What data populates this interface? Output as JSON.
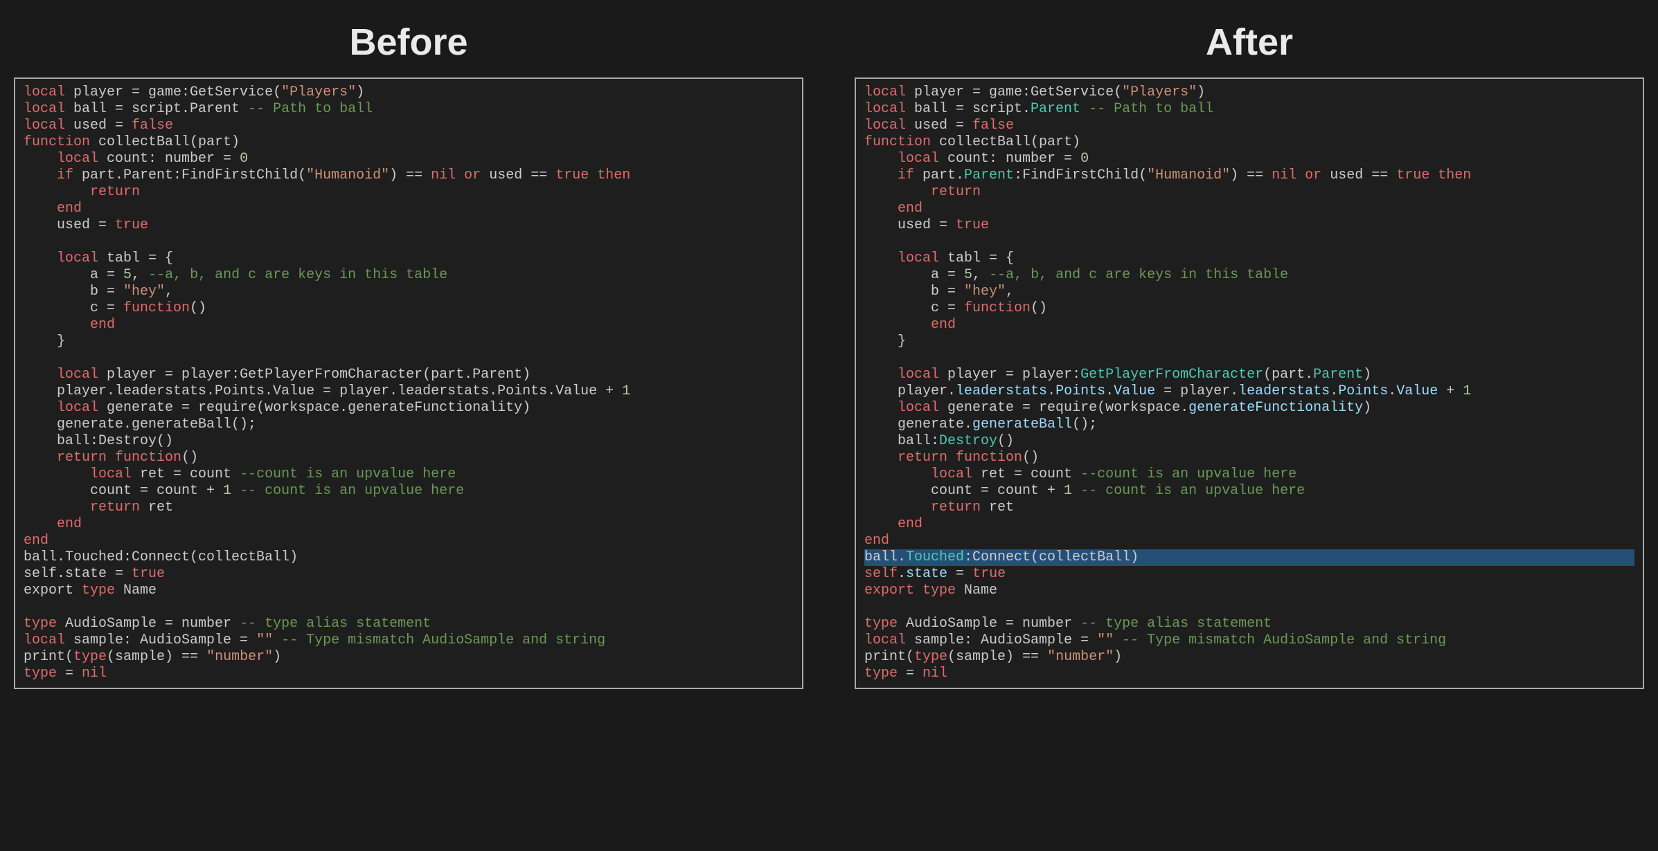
{
  "labels": {
    "before": "Before",
    "after": "After"
  },
  "colors": {
    "bg": "#1a1a1a",
    "panel": "#1e1e1e",
    "border": "#aaa",
    "keyword": "#e06c6c",
    "string": "#ce9178",
    "number": "#b5cea8",
    "comment": "#6a9955",
    "member_after": "#4ec9b0",
    "prop_after": "#9cdcfe",
    "highlight_line": "#264f78",
    "text": "#ccc"
  },
  "code": {
    "before": [
      {
        "t": [
          [
            "kw",
            "local"
          ],
          [
            "def",
            " player = game:GetService("
          ],
          [
            "str",
            "\"Players\""
          ],
          [
            "def",
            ")"
          ]
        ]
      },
      {
        "t": [
          [
            "kw",
            "local"
          ],
          [
            "def",
            " ball = script.Parent "
          ],
          [
            "cmt",
            "-- Path to ball"
          ]
        ]
      },
      {
        "t": [
          [
            "kw",
            "local"
          ],
          [
            "def",
            " used = "
          ],
          [
            "bool",
            "false"
          ]
        ]
      },
      {
        "t": [
          [
            "kw",
            "function"
          ],
          [
            "def",
            " collectBall(part)"
          ]
        ]
      },
      {
        "t": [
          [
            "def",
            "    "
          ],
          [
            "kw",
            "local"
          ],
          [
            "def",
            " count: number = "
          ],
          [
            "num",
            "0"
          ]
        ]
      },
      {
        "t": [
          [
            "def",
            "    "
          ],
          [
            "kw",
            "if"
          ],
          [
            "def",
            " part.Parent:FindFirstChild("
          ],
          [
            "str",
            "\"Humanoid\""
          ],
          [
            "def",
            ") == "
          ],
          [
            "bool",
            "nil"
          ],
          [
            "def",
            " "
          ],
          [
            "kw",
            "or"
          ],
          [
            "def",
            " used == "
          ],
          [
            "bool",
            "true"
          ],
          [
            "def",
            " "
          ],
          [
            "kw",
            "then"
          ]
        ]
      },
      {
        "t": [
          [
            "def",
            "        "
          ],
          [
            "kw",
            "return"
          ]
        ]
      },
      {
        "t": [
          [
            "def",
            "    "
          ],
          [
            "kw",
            "end"
          ]
        ]
      },
      {
        "t": [
          [
            "def",
            "    used = "
          ],
          [
            "bool",
            "true"
          ]
        ]
      },
      {
        "t": [
          [
            "def",
            ""
          ]
        ]
      },
      {
        "t": [
          [
            "def",
            "    "
          ],
          [
            "kw",
            "local"
          ],
          [
            "def",
            " tabl = {"
          ]
        ]
      },
      {
        "t": [
          [
            "def",
            "        a = "
          ],
          [
            "num",
            "5"
          ],
          [
            "def",
            ", "
          ],
          [
            "cmt",
            "--a, b, and c are keys in this table"
          ]
        ]
      },
      {
        "t": [
          [
            "def",
            "        b = "
          ],
          [
            "str",
            "\"hey\""
          ],
          [
            "def",
            ","
          ]
        ]
      },
      {
        "t": [
          [
            "def",
            "        c = "
          ],
          [
            "kw",
            "function"
          ],
          [
            "def",
            "()"
          ]
        ]
      },
      {
        "t": [
          [
            "def",
            "        "
          ],
          [
            "kw",
            "end"
          ]
        ]
      },
      {
        "t": [
          [
            "def",
            "    }"
          ]
        ]
      },
      {
        "t": [
          [
            "def",
            ""
          ]
        ]
      },
      {
        "t": [
          [
            "def",
            "    "
          ],
          [
            "kw",
            "local"
          ],
          [
            "def",
            " player = player:GetPlayerFromCharacter(part.Parent)"
          ]
        ]
      },
      {
        "t": [
          [
            "def",
            "    player.leaderstats.Points.Value = player.leaderstats.Points.Value + "
          ],
          [
            "num",
            "1"
          ]
        ]
      },
      {
        "t": [
          [
            "def",
            "    "
          ],
          [
            "kw",
            "local"
          ],
          [
            "def",
            " generate = require(workspace.generateFunctionality)"
          ]
        ]
      },
      {
        "t": [
          [
            "def",
            "    generate.generateBall();"
          ]
        ]
      },
      {
        "t": [
          [
            "def",
            "    ball:Destroy()"
          ]
        ]
      },
      {
        "t": [
          [
            "def",
            "    "
          ],
          [
            "kw",
            "return"
          ],
          [
            "def",
            " "
          ],
          [
            "kw",
            "function"
          ],
          [
            "def",
            "()"
          ]
        ]
      },
      {
        "t": [
          [
            "def",
            "        "
          ],
          [
            "kw",
            "local"
          ],
          [
            "def",
            " ret = count "
          ],
          [
            "cmt",
            "--count is an upvalue here"
          ]
        ]
      },
      {
        "t": [
          [
            "def",
            "        count = count + "
          ],
          [
            "num",
            "1"
          ],
          [
            "def",
            " "
          ],
          [
            "cmt",
            "-- count is an upvalue here"
          ]
        ]
      },
      {
        "t": [
          [
            "def",
            "        "
          ],
          [
            "kw",
            "return"
          ],
          [
            "def",
            " ret"
          ]
        ]
      },
      {
        "t": [
          [
            "def",
            "    "
          ],
          [
            "kw",
            "end"
          ]
        ]
      },
      {
        "t": [
          [
            "kw",
            "end"
          ]
        ]
      },
      {
        "t": [
          [
            "def",
            "ball.Touched:Connect(collectBall)"
          ]
        ]
      },
      {
        "t": [
          [
            "def",
            "self.state = "
          ],
          [
            "bool",
            "true"
          ]
        ]
      },
      {
        "t": [
          [
            "def",
            "export "
          ],
          [
            "kw",
            "type"
          ],
          [
            "def",
            " Name"
          ]
        ]
      },
      {
        "t": [
          [
            "def",
            ""
          ]
        ]
      },
      {
        "t": [
          [
            "kw",
            "type"
          ],
          [
            "def",
            " AudioSample = number "
          ],
          [
            "cmt",
            "-- type alias statement"
          ]
        ]
      },
      {
        "t": [
          [
            "kw",
            "local"
          ],
          [
            "def",
            " sample: AudioSample = "
          ],
          [
            "str",
            "\"\""
          ],
          [
            "def",
            " "
          ],
          [
            "cmt",
            "-- Type mismatch AudioSample and string"
          ]
        ]
      },
      {
        "t": [
          [
            "def",
            "print("
          ],
          [
            "kw",
            "type"
          ],
          [
            "def",
            "(sample) == "
          ],
          [
            "str",
            "\"number\""
          ],
          [
            "def",
            ")"
          ]
        ]
      },
      {
        "t": [
          [
            "kw",
            "type"
          ],
          [
            "def",
            " = "
          ],
          [
            "bool",
            "nil"
          ]
        ]
      }
    ],
    "after": [
      {
        "t": [
          [
            "kw",
            "local"
          ],
          [
            "def",
            " player = game:GetService("
          ],
          [
            "str",
            "\"Players\""
          ],
          [
            "def",
            ")"
          ]
        ]
      },
      {
        "t": [
          [
            "kw",
            "local"
          ],
          [
            "def",
            " ball = script."
          ],
          [
            "mem",
            "Parent"
          ],
          [
            "def",
            " "
          ],
          [
            "cmt",
            "-- Path to ball"
          ]
        ]
      },
      {
        "t": [
          [
            "kw",
            "local"
          ],
          [
            "def",
            " used = "
          ],
          [
            "bool",
            "false"
          ]
        ]
      },
      {
        "t": [
          [
            "kw",
            "function"
          ],
          [
            "def",
            " collectBall(part)"
          ]
        ]
      },
      {
        "t": [
          [
            "def",
            "    "
          ],
          [
            "kw",
            "local"
          ],
          [
            "def",
            " count: number = "
          ],
          [
            "num",
            "0"
          ]
        ]
      },
      {
        "t": [
          [
            "def",
            "    "
          ],
          [
            "kw",
            "if"
          ],
          [
            "def",
            " part."
          ],
          [
            "mem",
            "Parent"
          ],
          [
            "def",
            ":FindFirstChild("
          ],
          [
            "str",
            "\"Humanoid\""
          ],
          [
            "def",
            ") == "
          ],
          [
            "bool",
            "nil"
          ],
          [
            "def",
            " "
          ],
          [
            "kw",
            "or"
          ],
          [
            "def",
            " used == "
          ],
          [
            "bool",
            "true"
          ],
          [
            "def",
            " "
          ],
          [
            "kw",
            "then"
          ]
        ]
      },
      {
        "t": [
          [
            "def",
            "        "
          ],
          [
            "kw",
            "return"
          ]
        ]
      },
      {
        "t": [
          [
            "def",
            "    "
          ],
          [
            "kw",
            "end"
          ]
        ]
      },
      {
        "t": [
          [
            "def",
            "    used = "
          ],
          [
            "bool",
            "true"
          ]
        ]
      },
      {
        "t": [
          [
            "def",
            ""
          ]
        ]
      },
      {
        "t": [
          [
            "def",
            "    "
          ],
          [
            "kw",
            "local"
          ],
          [
            "def",
            " tabl = {"
          ]
        ]
      },
      {
        "t": [
          [
            "def",
            "        a = "
          ],
          [
            "num",
            "5"
          ],
          [
            "def",
            ", "
          ],
          [
            "cmt",
            "--a, b, and c are keys in this table"
          ]
        ]
      },
      {
        "t": [
          [
            "def",
            "        b = "
          ],
          [
            "str",
            "\"hey\""
          ],
          [
            "def",
            ","
          ]
        ]
      },
      {
        "t": [
          [
            "def",
            "        c = "
          ],
          [
            "kw",
            "function"
          ],
          [
            "def",
            "()"
          ]
        ]
      },
      {
        "t": [
          [
            "def",
            "        "
          ],
          [
            "kw",
            "end"
          ]
        ]
      },
      {
        "t": [
          [
            "def",
            "    }"
          ]
        ]
      },
      {
        "t": [
          [
            "def",
            ""
          ]
        ]
      },
      {
        "t": [
          [
            "def",
            "    "
          ],
          [
            "kw",
            "local"
          ],
          [
            "def",
            " player = player:"
          ],
          [
            "mem",
            "GetPlayerFromCharacter"
          ],
          [
            "def",
            "(part."
          ],
          [
            "mem",
            "Parent"
          ],
          [
            "def",
            ")"
          ]
        ]
      },
      {
        "t": [
          [
            "def",
            "    player."
          ],
          [
            "prop",
            "leaderstats"
          ],
          [
            "def",
            "."
          ],
          [
            "prop",
            "Points"
          ],
          [
            "def",
            "."
          ],
          [
            "prop",
            "Value"
          ],
          [
            "def",
            " = player."
          ],
          [
            "prop",
            "leaderstats"
          ],
          [
            "def",
            "."
          ],
          [
            "prop",
            "Points"
          ],
          [
            "def",
            "."
          ],
          [
            "prop",
            "Value"
          ],
          [
            "def",
            " + "
          ],
          [
            "num",
            "1"
          ]
        ]
      },
      {
        "t": [
          [
            "def",
            "    "
          ],
          [
            "kw",
            "local"
          ],
          [
            "def",
            " generate = require(workspace."
          ],
          [
            "prop",
            "generateFunctionality"
          ],
          [
            "def",
            ")"
          ]
        ]
      },
      {
        "t": [
          [
            "def",
            "    generate."
          ],
          [
            "prop",
            "generateBall"
          ],
          [
            "def",
            "();"
          ]
        ]
      },
      {
        "t": [
          [
            "def",
            "    ball:"
          ],
          [
            "mem",
            "Destroy"
          ],
          [
            "def",
            "()"
          ]
        ]
      },
      {
        "t": [
          [
            "def",
            "    "
          ],
          [
            "kw",
            "return"
          ],
          [
            "def",
            " "
          ],
          [
            "kw",
            "function"
          ],
          [
            "def",
            "()"
          ]
        ]
      },
      {
        "t": [
          [
            "def",
            "        "
          ],
          [
            "kw",
            "local"
          ],
          [
            "def",
            " ret = count "
          ],
          [
            "cmt",
            "--count is an upvalue here"
          ]
        ]
      },
      {
        "t": [
          [
            "def",
            "        count = count + "
          ],
          [
            "num",
            "1"
          ],
          [
            "def",
            " "
          ],
          [
            "cmt",
            "-- count is an upvalue here"
          ]
        ]
      },
      {
        "t": [
          [
            "def",
            "        "
          ],
          [
            "kw",
            "return"
          ],
          [
            "def",
            " ret"
          ]
        ]
      },
      {
        "t": [
          [
            "def",
            "    "
          ],
          [
            "kw",
            "end"
          ]
        ]
      },
      {
        "t": [
          [
            "kw",
            "end"
          ]
        ]
      },
      {
        "hl": true,
        "t": [
          [
            "def",
            "ball."
          ],
          [
            "mem",
            "Touched"
          ],
          [
            "def",
            ":Connect(collectBall)"
          ]
        ]
      },
      {
        "t": [
          [
            "kw",
            "self"
          ],
          [
            "def",
            "."
          ],
          [
            "prop",
            "state"
          ],
          [
            "def",
            " = "
          ],
          [
            "bool",
            "true"
          ]
        ]
      },
      {
        "t": [
          [
            "kw",
            "export"
          ],
          [
            "def",
            " "
          ],
          [
            "kw",
            "type"
          ],
          [
            "def",
            " Name"
          ]
        ]
      },
      {
        "t": [
          [
            "def",
            ""
          ]
        ]
      },
      {
        "t": [
          [
            "kw",
            "type"
          ],
          [
            "def",
            " AudioSample = number "
          ],
          [
            "cmt",
            "-- type alias statement"
          ]
        ]
      },
      {
        "t": [
          [
            "kw",
            "local"
          ],
          [
            "def",
            " sample: AudioSample = "
          ],
          [
            "str",
            "\"\""
          ],
          [
            "def",
            " "
          ],
          [
            "cmt",
            "-- Type mismatch AudioSample and string"
          ]
        ]
      },
      {
        "t": [
          [
            "def",
            "print("
          ],
          [
            "kw",
            "type"
          ],
          [
            "def",
            "(sample) == "
          ],
          [
            "str",
            "\"number\""
          ],
          [
            "def",
            ")"
          ]
        ]
      },
      {
        "t": [
          [
            "kw",
            "type"
          ],
          [
            "def",
            " = "
          ],
          [
            "bool",
            "nil"
          ]
        ]
      }
    ]
  }
}
